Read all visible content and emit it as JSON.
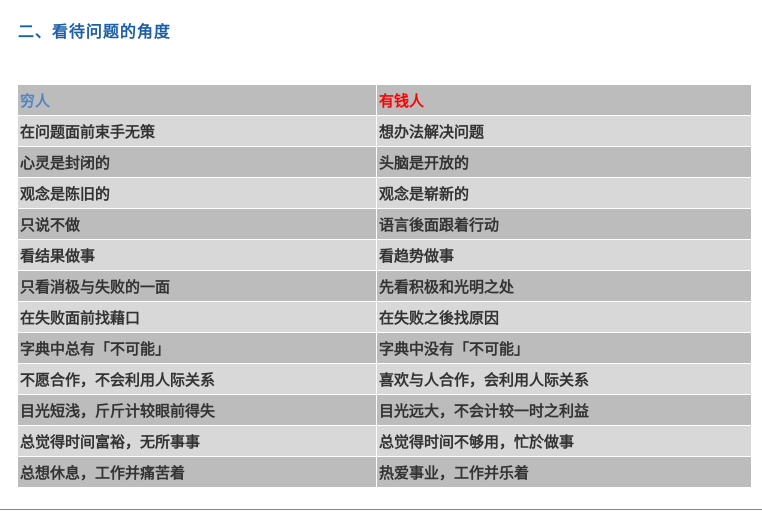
{
  "heading": "二、看待问题的角度",
  "colors": {
    "heading": "#1a5fa8",
    "poor_header": "#4f86c6",
    "rich_header": "#ff0000",
    "row_dark": "#bcbcbc",
    "row_light": "#d8d8d8"
  },
  "table": {
    "headers": {
      "poor": "穷人",
      "rich": "有钱人"
    },
    "rows": [
      {
        "poor": "在问题面前束手无策",
        "rich": "想办法解决问题"
      },
      {
        "poor": "心灵是封闭的",
        "rich": "头脑是开放的"
      },
      {
        "poor": "观念是陈旧的",
        "rich": "观念是崭新的"
      },
      {
        "poor": "只说不做",
        "rich": "语言後面跟着行动"
      },
      {
        "poor": "看结果做事",
        "rich": "看趋势做事"
      },
      {
        "poor": "只看消极与失败的一面",
        "rich": "先看积极和光明之处"
      },
      {
        "poor": "在失败面前找藉口",
        "rich": "在失败之後找原因"
      },
      {
        "poor": "字典中总有「不可能」",
        "rich": "字典中没有「不可能」"
      },
      {
        "poor": "不愿合作，不会利用人际关系",
        "rich": "喜欢与人合作，会利用人际关系"
      },
      {
        "poor": "目光短浅，斤斤计较眼前得失",
        "rich": "目光远大，不会计较一时之利益"
      },
      {
        "poor": "总觉得时间富裕，无所事事",
        "rich": "总觉得时间不够用，忙於做事"
      },
      {
        "poor": "总想休息，工作并痛苦着",
        "rich": "热爱事业，工作并乐着"
      }
    ]
  }
}
